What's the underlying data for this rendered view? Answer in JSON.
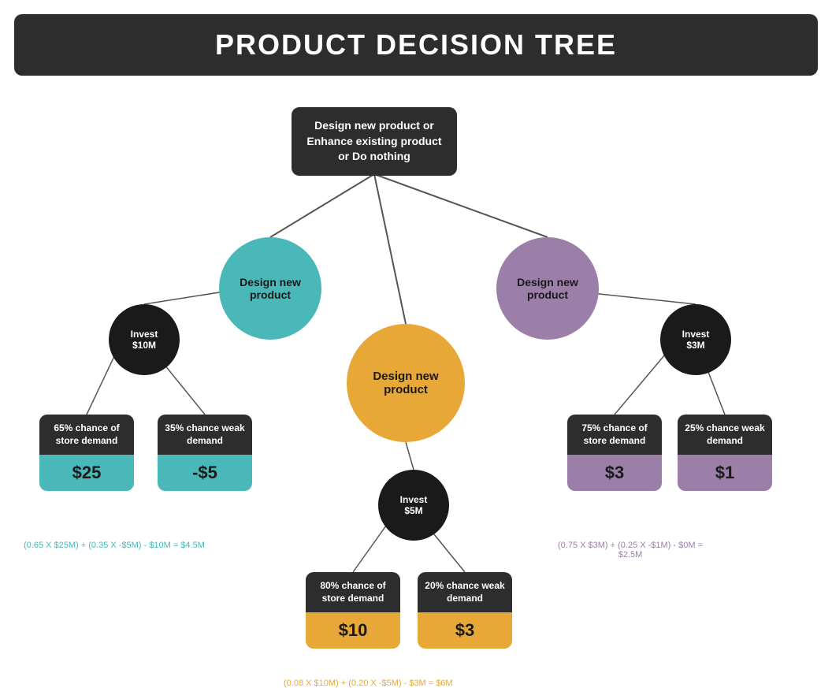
{
  "header": {
    "title": "PRODUCT DECISION TREE"
  },
  "root": {
    "label": "Design new product or Enhance existing product or Do nothing"
  },
  "nodes": {
    "teal": {
      "label": "Design new\nproduct"
    },
    "purple": {
      "label": "Design new\nproduct"
    },
    "orange": {
      "label": "Design new\nproduct"
    },
    "invest_left": {
      "label": "Invest\n$10M"
    },
    "invest_right": {
      "label": "Invest\n$3M"
    },
    "invest_center": {
      "label": "Invest\n$5M"
    }
  },
  "cards": {
    "teal_left": {
      "top": "65% chance of store demand",
      "bottom": "$25"
    },
    "teal_right": {
      "top": "35% chance weak demand",
      "bottom": "-$5"
    },
    "orange_left": {
      "top": "80% chance of store demand",
      "bottom": "$10"
    },
    "orange_right": {
      "top": "20% chance weak demand",
      "bottom": "$3"
    },
    "purple_left": {
      "top": "75% chance of store demand",
      "bottom": "$3"
    },
    "purple_right": {
      "top": "25% chance weak demand",
      "bottom": "$1"
    }
  },
  "formulas": {
    "teal": "(0.65 X $25M) + (0.35 X -$5M) - $10M = $4.5M",
    "orange": "(0.08 X $10M) + (0.20 X -$5M) - $3M = $6M",
    "purple": "(0.75 X $3M) + (0.25 X -$1M) - $0M = $2.5M"
  },
  "colors": {
    "teal": "#4ab8b8",
    "purple": "#9b7fa8",
    "orange": "#e8a838",
    "dark": "#1a1a1a",
    "header_bg": "#2d2d2d"
  }
}
